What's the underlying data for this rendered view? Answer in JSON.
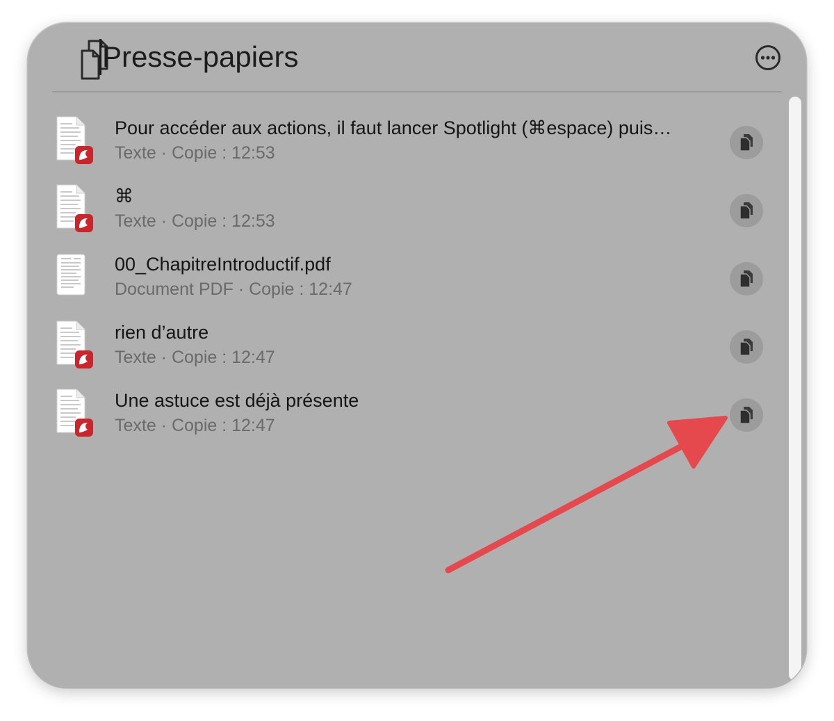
{
  "header": {
    "title": "Presse-papiers",
    "clipboard_icon": "clipboard-documents-icon",
    "more_icon": "ellipsis-circle-icon"
  },
  "items": [
    {
      "title": "Pour accéder aux actions, il faut lancer Spotlight (⌘espace) puis…",
      "meta": "Texte · Copie : 12:53",
      "icon": "text-document-icon"
    },
    {
      "title": "⌘",
      "meta": "Texte · Copie : 12:53",
      "icon": "text-document-icon"
    },
    {
      "title": "00_ChapitreIntroductif.pdf",
      "meta": "Document PDF · Copie : 12:47",
      "icon": "pdf-document-icon"
    },
    {
      "title": "rien d’autre",
      "meta": "Texte · Copie : 12:47",
      "icon": "text-document-icon"
    },
    {
      "title": "Une astuce est déjà présente",
      "meta": "Texte · Copie : 12:47",
      "icon": "text-document-icon"
    }
  ],
  "colors": {
    "panel_background": "#b0b0b0",
    "annotation_arrow": "#e5484d",
    "app_badge": "#c8262c"
  }
}
